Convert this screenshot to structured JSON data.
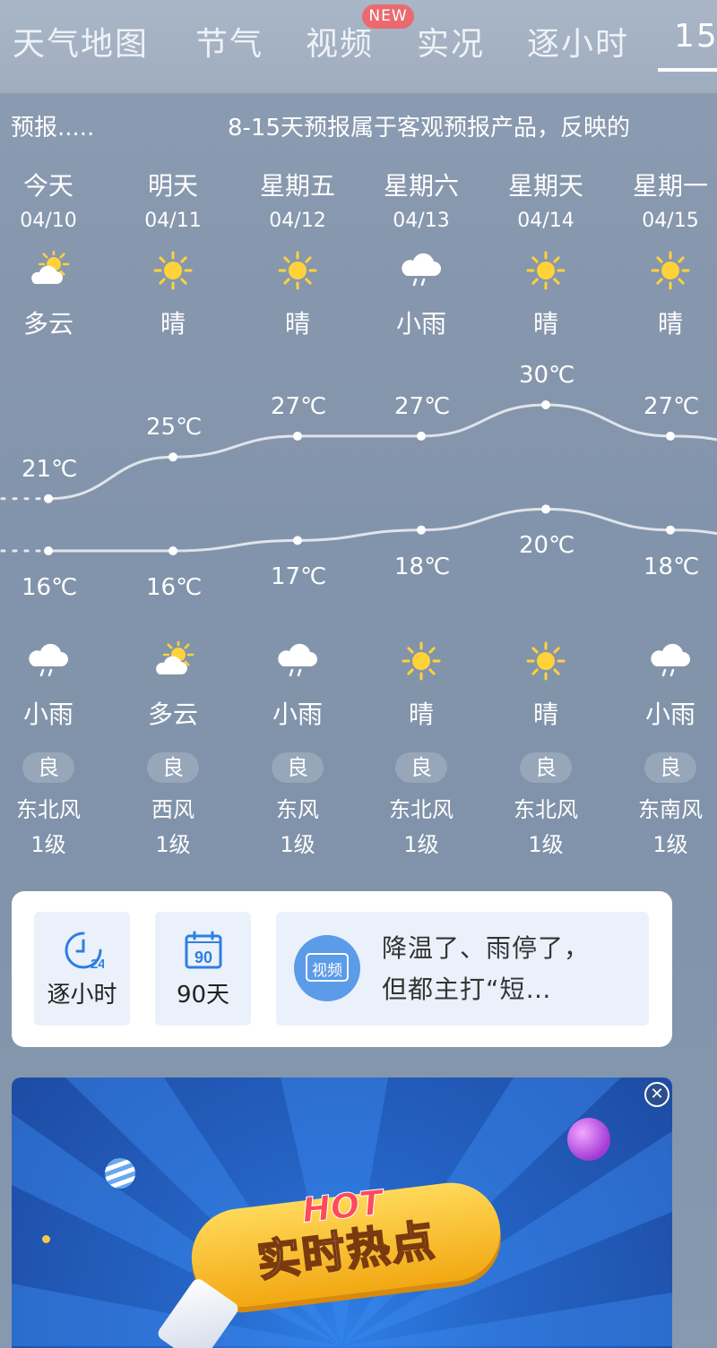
{
  "tabs": [
    {
      "label": "天气地图"
    },
    {
      "label": "节气"
    },
    {
      "label": "视频"
    },
    {
      "label": "实况"
    },
    {
      "label": "逐小时"
    },
    {
      "label": "15"
    }
  ],
  "new_badge": "NEW",
  "ticker": {
    "left": "预报.....",
    "right": "8-15天预报属于客观预报产品，反映的"
  },
  "days": [
    {
      "name": "今天",
      "date": "04/10",
      "day_weather": "多云",
      "day_icon": "partly-cloudy-icon",
      "high": "21℃",
      "low": "16℃",
      "night_weather": "小雨",
      "night_icon": "light-rain-icon",
      "aqi": "良",
      "wind": "东北风",
      "level": "1级"
    },
    {
      "name": "明天",
      "date": "04/11",
      "day_weather": "晴",
      "day_icon": "sun-icon",
      "high": "25℃",
      "low": "16℃",
      "night_weather": "多云",
      "night_icon": "partly-cloudy-icon",
      "aqi": "良",
      "wind": "西风",
      "level": "1级"
    },
    {
      "name": "星期五",
      "date": "04/12",
      "day_weather": "晴",
      "day_icon": "sun-icon",
      "high": "27℃",
      "low": "17℃",
      "night_weather": "小雨",
      "night_icon": "light-rain-icon",
      "aqi": "良",
      "wind": "东风",
      "level": "1级"
    },
    {
      "name": "星期六",
      "date": "04/13",
      "day_weather": "小雨",
      "day_icon": "light-rain-icon",
      "high": "27℃",
      "low": "18℃",
      "night_weather": "晴",
      "night_icon": "sun-icon",
      "aqi": "良",
      "wind": "东北风",
      "level": "1级"
    },
    {
      "name": "星期天",
      "date": "04/14",
      "day_weather": "晴",
      "day_icon": "sun-icon",
      "high": "30℃",
      "low": "20℃",
      "night_weather": "晴",
      "night_icon": "sun-icon",
      "aqi": "良",
      "wind": "东北风",
      "level": "1级"
    },
    {
      "name": "星期一",
      "date": "04/15",
      "day_weather": "晴",
      "day_icon": "sun-icon",
      "high": "27℃",
      "low": "18℃",
      "night_weather": "小雨",
      "night_icon": "light-rain-icon",
      "aqi": "良",
      "wind": "东南风",
      "level": "1级"
    }
  ],
  "chart_data": {
    "type": "line",
    "categories": [
      "04/10",
      "04/11",
      "04/12",
      "04/13",
      "04/14",
      "04/15"
    ],
    "series": [
      {
        "values": [
          21,
          25,
          27,
          27,
          30,
          27
        ]
      },
      {
        "values": [
          16,
          16,
          17,
          18,
          20,
          18
        ]
      }
    ]
  },
  "shortcuts": {
    "hourly_label": "逐小时",
    "hourly_icon_text": "24",
    "days90_label": "90天",
    "days90_icon_text": "90",
    "video_icon_text": "视频",
    "news_line1": "降温了、雨停了，",
    "news_line2": "但都主打“短…"
  },
  "promo": {
    "hot_text": "HOT",
    "title": "实时热点"
  },
  "colors": {
    "sun": "#ffd23a",
    "tile_bg": "#eaf1fb",
    "accent_blue": "#2f7ee0",
    "promo_yellow": "#f6b81c"
  }
}
